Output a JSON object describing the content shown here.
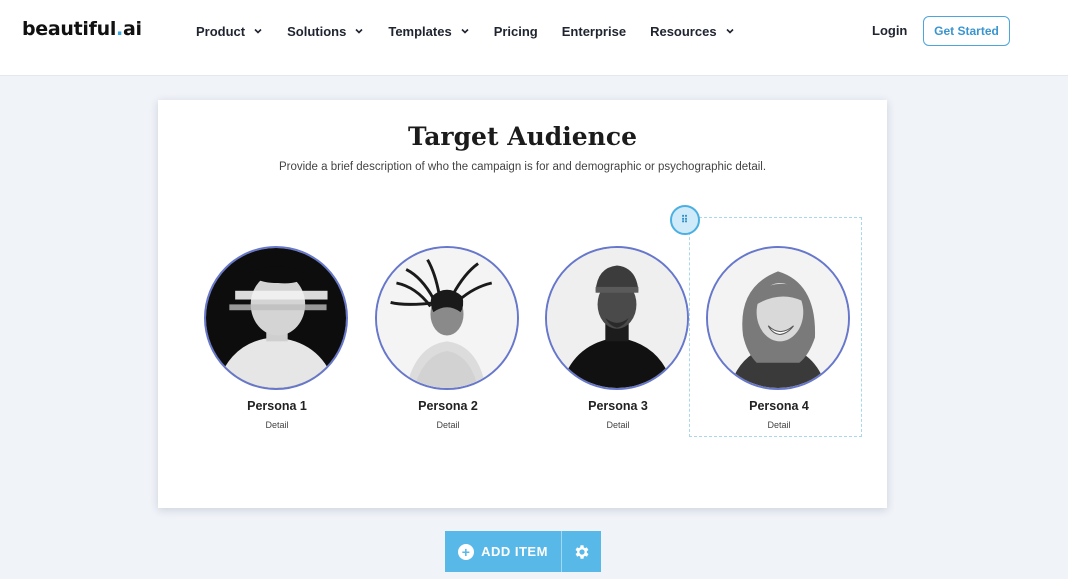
{
  "nav": {
    "logo_main": "beautiful",
    "logo_dot": ".",
    "logo_suffix": "ai",
    "items": [
      {
        "label": "Product",
        "has_dropdown": true
      },
      {
        "label": "Solutions",
        "has_dropdown": true
      },
      {
        "label": "Templates",
        "has_dropdown": true
      },
      {
        "label": "Pricing",
        "has_dropdown": false
      },
      {
        "label": "Enterprise",
        "has_dropdown": false
      },
      {
        "label": "Resources",
        "has_dropdown": true
      }
    ],
    "login_label": "Login",
    "cta_label": "Get Started"
  },
  "slide": {
    "title": "Target Audience",
    "subtitle": "Provide a brief description of who the campaign is for and demographic or psychographic detail.",
    "personas": [
      {
        "name": "Persona 1",
        "detail": "Detail"
      },
      {
        "name": "Persona 2",
        "detail": "Detail"
      },
      {
        "name": "Persona 3",
        "detail": "Detail"
      },
      {
        "name": "Persona 4",
        "detail": "Detail"
      }
    ]
  },
  "toolbar": {
    "add_item_label": "ADD ITEM",
    "add_icon": "plus-circle-icon",
    "settings_icon": "gear-icon"
  },
  "colors": {
    "accent": "#58b9e8",
    "avatar_ring": "#6677cc",
    "cta_border": "#4ca6dc"
  }
}
